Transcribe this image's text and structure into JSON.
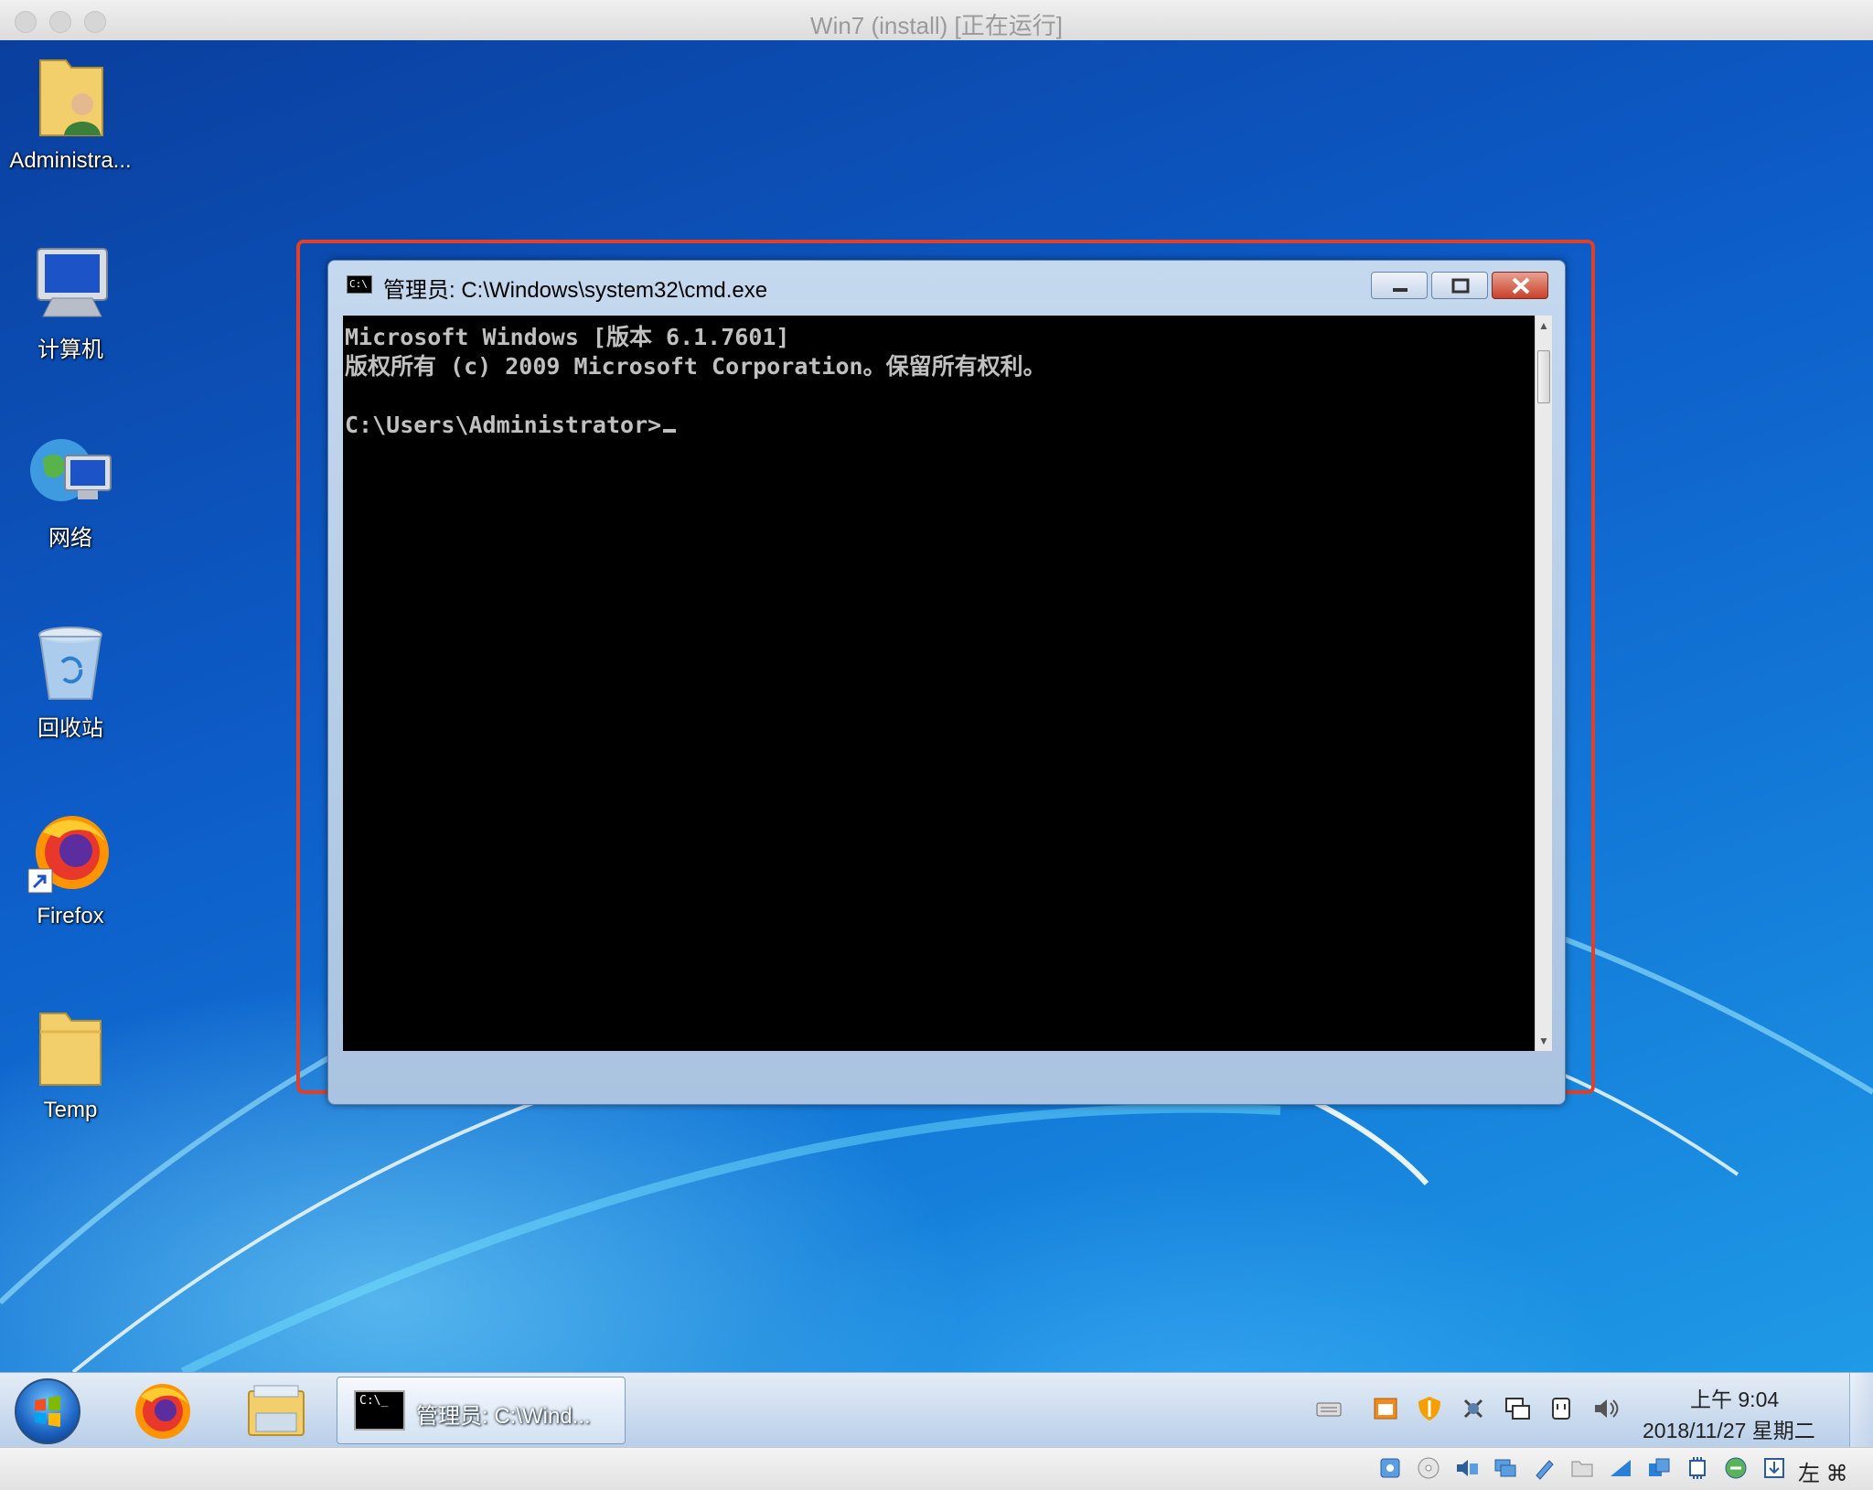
{
  "host": {
    "title": "Win7 (install) [正在运行]"
  },
  "desktop": {
    "icons": [
      {
        "label": "Administra...",
        "icon": "user-folder-icon"
      },
      {
        "label": "计算机",
        "icon": "computer-icon"
      },
      {
        "label": "网络",
        "icon": "network-icon"
      },
      {
        "label": "回收站",
        "icon": "recycle-bin-icon"
      },
      {
        "label": "Firefox",
        "icon": "firefox-icon"
      },
      {
        "label": "Temp",
        "icon": "folder-icon"
      }
    ]
  },
  "cmd_window": {
    "title": "管理员: C:\\Windows\\system32\\cmd.exe",
    "lines": [
      "Microsoft Windows [版本 6.1.7601]",
      "版权所有 (c) 2009 Microsoft Corporation。保留所有权利。",
      "",
      "C:\\Users\\Administrator>"
    ]
  },
  "taskbar": {
    "active_task_label": "管理员: C:\\Wind...",
    "clock_time": "上午 9:04",
    "clock_date": "2018/11/27 星期二",
    "tray_icons": [
      "keyboard-icon",
      "flag-icon",
      "shield-icon",
      "network-share-icon",
      "display-icon",
      "usb-icon",
      "volume-icon"
    ]
  },
  "vbox_status": {
    "icons": [
      "hdd-icon",
      "cd-icon",
      "audio-icon",
      "network-icon",
      "usb-icon",
      "shared-folder-icon",
      "display-icon",
      "snapshot-icon",
      "cpu-icon",
      "recording-icon",
      "arrow-down-icon"
    ],
    "host_key_label": "左 ⌘"
  },
  "colors": {
    "highlight": "#e0402a",
    "console_bg": "#000000",
    "console_fg": "#c0c0c0"
  }
}
